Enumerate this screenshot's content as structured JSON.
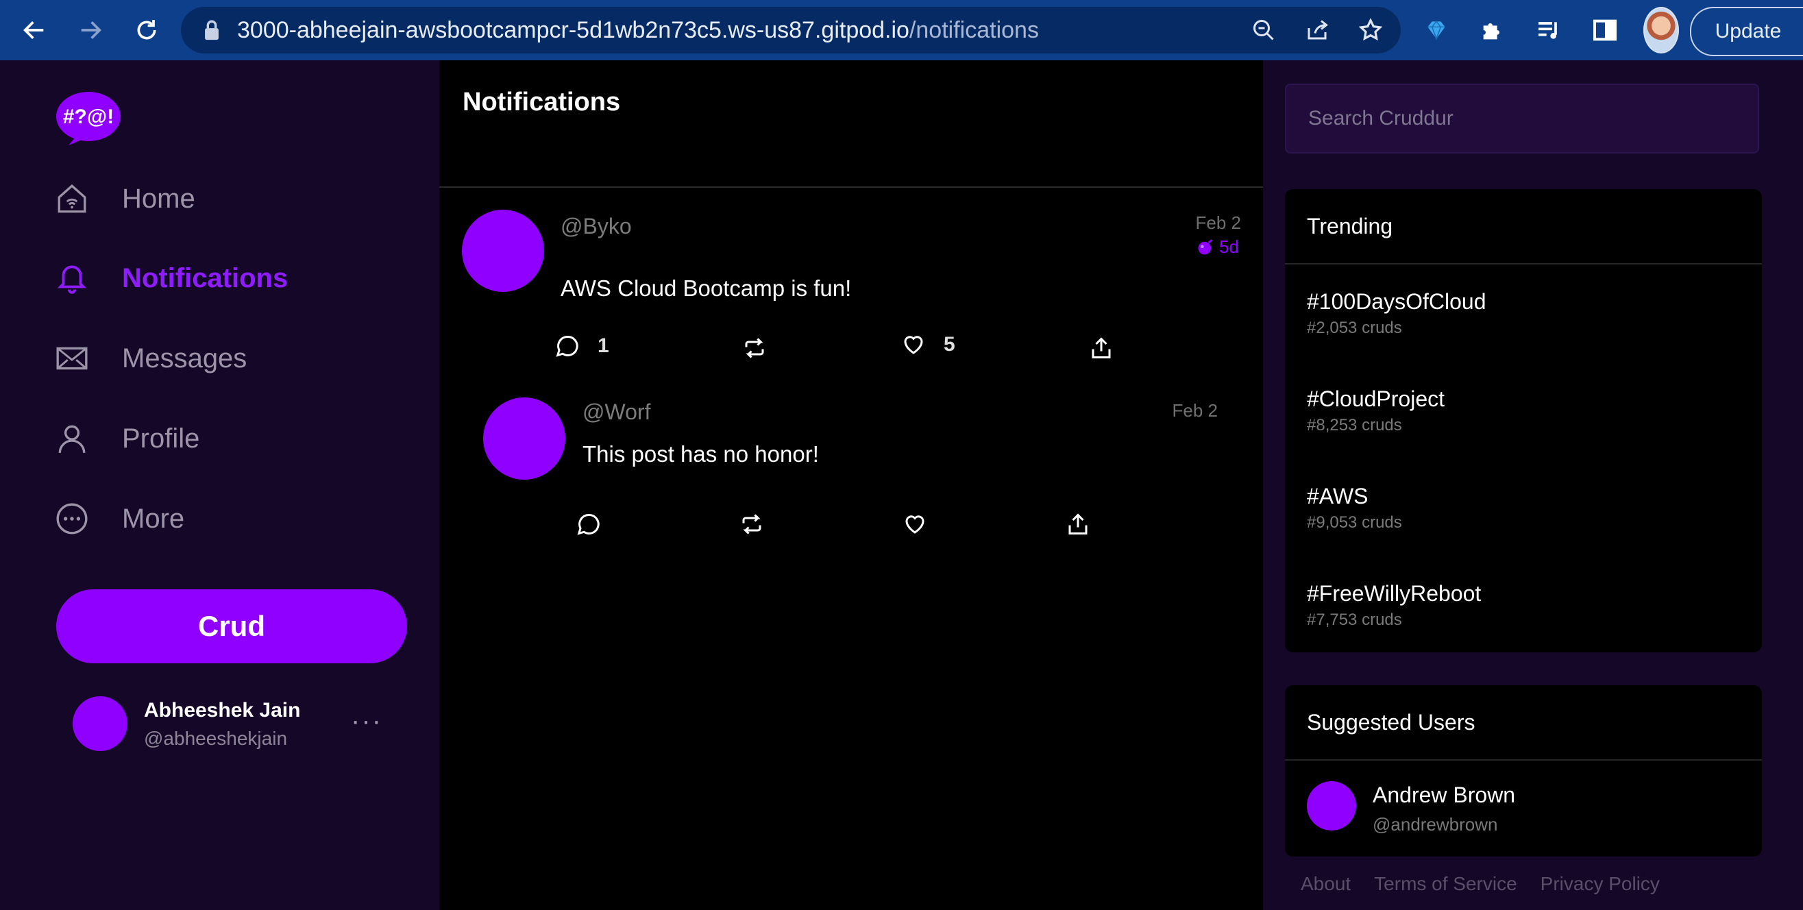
{
  "browser": {
    "url_host": "3000-abheejain-awsbootcampcr-5d1wb2n73c5.ws-us87.gitpod.io",
    "url_path": "/notifications",
    "update_label": "Update"
  },
  "sidebar": {
    "logo_text": "#?@!",
    "items": [
      {
        "label": "Home",
        "icon": "home-icon"
      },
      {
        "label": "Notifications",
        "icon": "bell-icon"
      },
      {
        "label": "Messages",
        "icon": "envelope-icon"
      },
      {
        "label": "Profile",
        "icon": "person-icon"
      },
      {
        "label": "More",
        "icon": "more-circle-icon"
      }
    ],
    "crud_label": "Crud",
    "user": {
      "name": "Abheeshek Jain",
      "handle": "@abheeshekjain",
      "menu": "···"
    }
  },
  "feed": {
    "title": "Notifications",
    "posts": [
      {
        "handle": "@Byko",
        "date": "Feb 2",
        "ttl": "5d",
        "message": "AWS Cloud Bootcamp is fun!",
        "reply_count": "1",
        "like_count": "5"
      },
      {
        "handle": "@Worf",
        "date": "Feb 2",
        "message": "This post has no honor!"
      }
    ]
  },
  "search": {
    "placeholder": "Search Cruddur"
  },
  "trending": {
    "title": "Trending",
    "items": [
      {
        "name": "#100DaysOfCloud",
        "count": "#2,053 cruds"
      },
      {
        "name": "#CloudProject",
        "count": "#8,253 cruds"
      },
      {
        "name": "#AWS",
        "count": "#9,053 cruds"
      },
      {
        "name": "#FreeWillyReboot",
        "count": "#7,753 cruds"
      }
    ]
  },
  "suggested": {
    "title": "Suggested Users",
    "users": [
      {
        "name": "Andrew Brown",
        "handle": "@andrewbrown"
      }
    ]
  },
  "footer": {
    "links": [
      "About",
      "Terms of Service",
      "Privacy Policy"
    ]
  },
  "colors": {
    "accent": "#8f00ff",
    "sidebar_bg": "#150727",
    "chrome_bg": "#0e3f8a"
  }
}
